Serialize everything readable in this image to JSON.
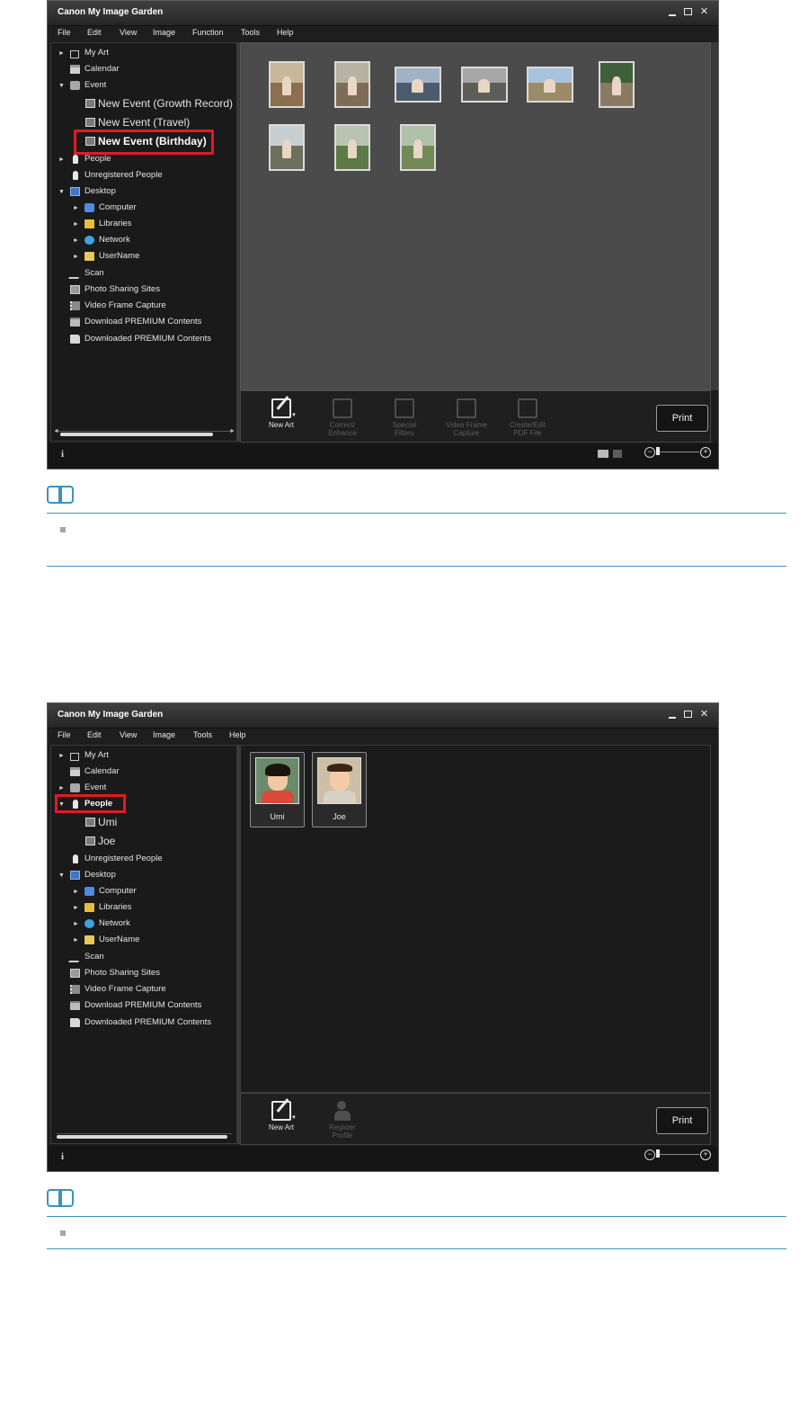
{
  "app": {
    "title": "Canon My Image Garden",
    "window_controls": {
      "minimize": "_",
      "maximize": "□",
      "close": "✕"
    },
    "menu": [
      "File",
      "Edit",
      "View",
      "Image",
      "Function",
      "Tools",
      "Help"
    ],
    "menu_second": [
      "File",
      "Edit",
      "View",
      "Image",
      "Tools",
      "Help"
    ]
  },
  "screen1": {
    "tree": [
      {
        "label": "My Art",
        "icon": "my-art-icon",
        "arrow": "►"
      },
      {
        "label": "Calendar",
        "icon": "calendar-icon",
        "arrow": ""
      },
      {
        "label": "Event",
        "icon": "event-icon",
        "arrow": "▼"
      },
      {
        "label": "New Event (Growth Record)",
        "icon": "event-frame-icon",
        "arrow": ""
      },
      {
        "label": "New Event (Travel)",
        "icon": "event-frame-icon",
        "arrow": ""
      },
      {
        "label": "New Event (Birthday)",
        "icon": "event-frame-icon",
        "arrow": ""
      },
      {
        "label": "People",
        "icon": "people-icon",
        "arrow": "►"
      },
      {
        "label": "Unregistered People",
        "icon": "unregistered-people-icon",
        "arrow": ""
      },
      {
        "label": "Desktop",
        "icon": "desktop-icon",
        "arrow": "▼"
      },
      {
        "label": "Computer",
        "icon": "computer-icon",
        "arrow": "►"
      },
      {
        "label": "Libraries",
        "icon": "libraries-icon",
        "arrow": "►"
      },
      {
        "label": "Network",
        "icon": "network-icon",
        "arrow": "►"
      },
      {
        "label": "UserName",
        "icon": "user-folder-icon",
        "arrow": "►"
      },
      {
        "label": "Scan",
        "icon": "scan-icon",
        "arrow": ""
      },
      {
        "label": "Photo Sharing Sites",
        "icon": "photo-sharing-icon",
        "arrow": ""
      },
      {
        "label": "Video Frame Capture",
        "icon": "video-frame-icon",
        "arrow": ""
      },
      {
        "label": "Download PREMIUM Contents",
        "icon": "download-icon",
        "arrow": ""
      },
      {
        "label": "Downloaded PREMIUM Contents",
        "icon": "folder-icon",
        "arrow": ""
      }
    ],
    "toolbar": [
      {
        "label": "New Art",
        "enabled": true
      },
      {
        "label": "Correct/\nEnhance",
        "enabled": false
      },
      {
        "label": "Special\nFilters",
        "enabled": false
      },
      {
        "label": "Video Frame\nCapture",
        "enabled": false
      },
      {
        "label": "Create/Edit\nPDF File",
        "enabled": false
      }
    ],
    "print": "Print",
    "info": "i"
  },
  "screen2": {
    "tree": [
      {
        "label": "My Art",
        "icon": "my-art-icon",
        "arrow": "►"
      },
      {
        "label": "Calendar",
        "icon": "calendar-icon",
        "arrow": ""
      },
      {
        "label": "Event",
        "icon": "event-icon",
        "arrow": "►"
      },
      {
        "label": "People",
        "icon": "people-icon",
        "arrow": "▼"
      },
      {
        "label": "Umi",
        "icon": "person-photo-icon",
        "arrow": ""
      },
      {
        "label": "Joe",
        "icon": "person-photo-icon",
        "arrow": ""
      },
      {
        "label": "Unregistered People",
        "icon": "unregistered-people-icon",
        "arrow": ""
      },
      {
        "label": "Desktop",
        "icon": "desktop-icon",
        "arrow": "▼"
      },
      {
        "label": "Computer",
        "icon": "computer-icon",
        "arrow": "►"
      },
      {
        "label": "Libraries",
        "icon": "libraries-icon",
        "arrow": "►"
      },
      {
        "label": "Network",
        "icon": "network-icon",
        "arrow": "►"
      },
      {
        "label": "UserName",
        "icon": "user-folder-icon",
        "arrow": "►"
      },
      {
        "label": "Scan",
        "icon": "scan-icon",
        "arrow": ""
      },
      {
        "label": "Photo Sharing Sites",
        "icon": "photo-sharing-icon",
        "arrow": ""
      },
      {
        "label": "Video Frame Capture",
        "icon": "video-frame-icon",
        "arrow": ""
      },
      {
        "label": "Download PREMIUM Contents",
        "icon": "download-icon",
        "arrow": ""
      },
      {
        "label": "Downloaded PREMIUM Contents",
        "icon": "folder-icon",
        "arrow": ""
      }
    ],
    "people": [
      {
        "name": "Umi",
        "shirt": "#d94a3b"
      },
      {
        "name": "Joe",
        "shirt": "#d8d2c4"
      }
    ],
    "toolbar": [
      {
        "label": "New Art",
        "enabled": true
      },
      {
        "label": "Register\nProfile",
        "enabled": false
      }
    ],
    "print": "Print",
    "info": "i"
  },
  "colors": {
    "highlight": "#e21a23",
    "note_accent": "#3b93c1",
    "window_bg": "#1c1c1c"
  }
}
